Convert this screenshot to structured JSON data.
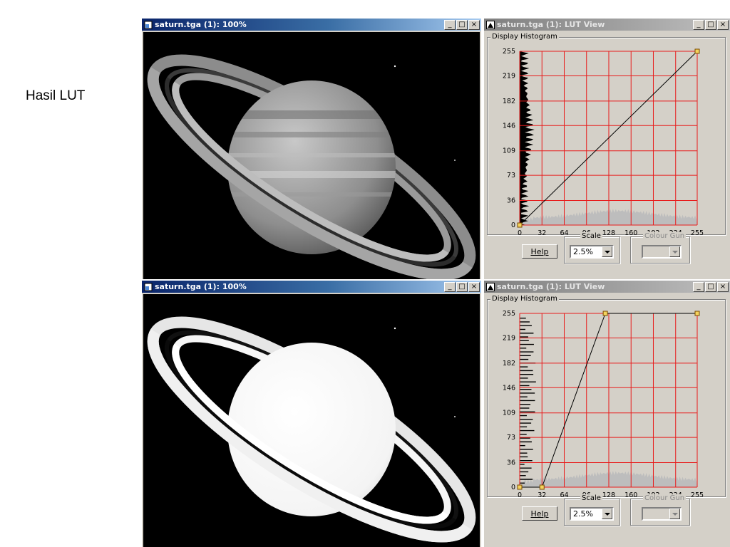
{
  "slide": {
    "label": "Hasil LUT"
  },
  "top_image_window": {
    "title": "saturn.tga (1): 100%"
  },
  "top_lut_window": {
    "title": "saturn.tga (1): LUT View",
    "histogram_group": "Display Histogram",
    "help_label": "Help",
    "scale_label": "Scale",
    "scale_value": "2.5%",
    "colour_gun_label": "Colour Gun",
    "lut_curve": [
      [
        0,
        0
      ],
      [
        255,
        255
      ]
    ]
  },
  "bottom_image_window": {
    "title": "saturn.tga (1): 100%"
  },
  "bottom_lut_window": {
    "title": "saturn.tga (1): LUT View",
    "histogram_group": "Display Histogram",
    "help_label": "Help",
    "scale_label": "Scale",
    "scale_value": "2.5%",
    "colour_gun_label": "Colour Gun",
    "lut_curve": [
      [
        0,
        0
      ],
      [
        32,
        0
      ],
      [
        123,
        255
      ],
      [
        255,
        255
      ]
    ]
  },
  "histogram_axes": {
    "y_ticks": [
      "255",
      "219",
      "182",
      "146",
      "109",
      "73",
      "36",
      "0"
    ],
    "x_ticks": [
      "0",
      "32",
      "64",
      "96",
      "128",
      "160",
      "192",
      "224",
      "255"
    ]
  },
  "window_controls": {
    "minimize": "_",
    "maximize": "□",
    "close": "×"
  },
  "colors": {
    "grid": "#e81c1c",
    "title_active": "#0a246a",
    "window_face": "#d4d0c8"
  }
}
